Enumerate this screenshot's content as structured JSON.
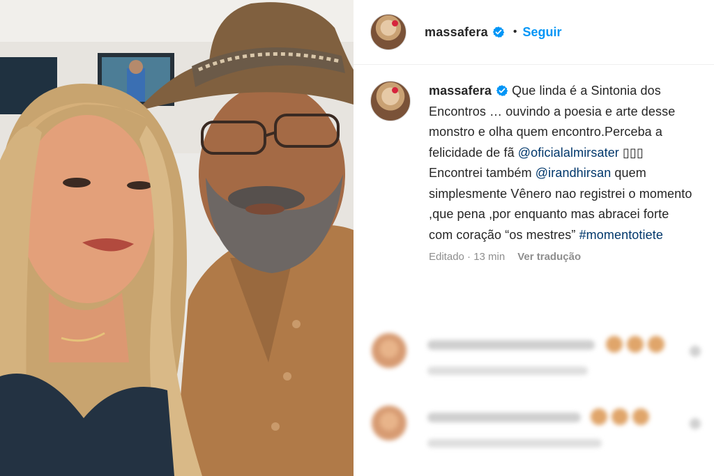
{
  "post": {
    "username": "massafera",
    "follow_label": "Seguir",
    "separator": "•",
    "caption": {
      "username": "massafera",
      "text_1": " Que linda é a Sintonia dos Encontros … ouvindo a poesia e arte desse monstro e olha quem encontro.Perceba a felicidade de fã ",
      "mention_1": "@oficialalmirsater",
      "text_2": " ▯▯▯ Encontrei também ",
      "mention_2": "@irandhirsan",
      "text_3": " quem simplesmente Vênero nao registrei o momento ,que pena ,por enquanto mas abracei forte com coração “os mestres” ",
      "hashtag": "#momentotiete"
    },
    "meta": {
      "edited": "Editado · 13 min",
      "translate": "Ver tradução"
    }
  },
  "icons": {
    "verified": "verified-badge-icon",
    "heart": "heart-icon"
  },
  "colors": {
    "accent": "#0095f6",
    "mention": "#00376b",
    "muted": "#8e8e8e"
  }
}
